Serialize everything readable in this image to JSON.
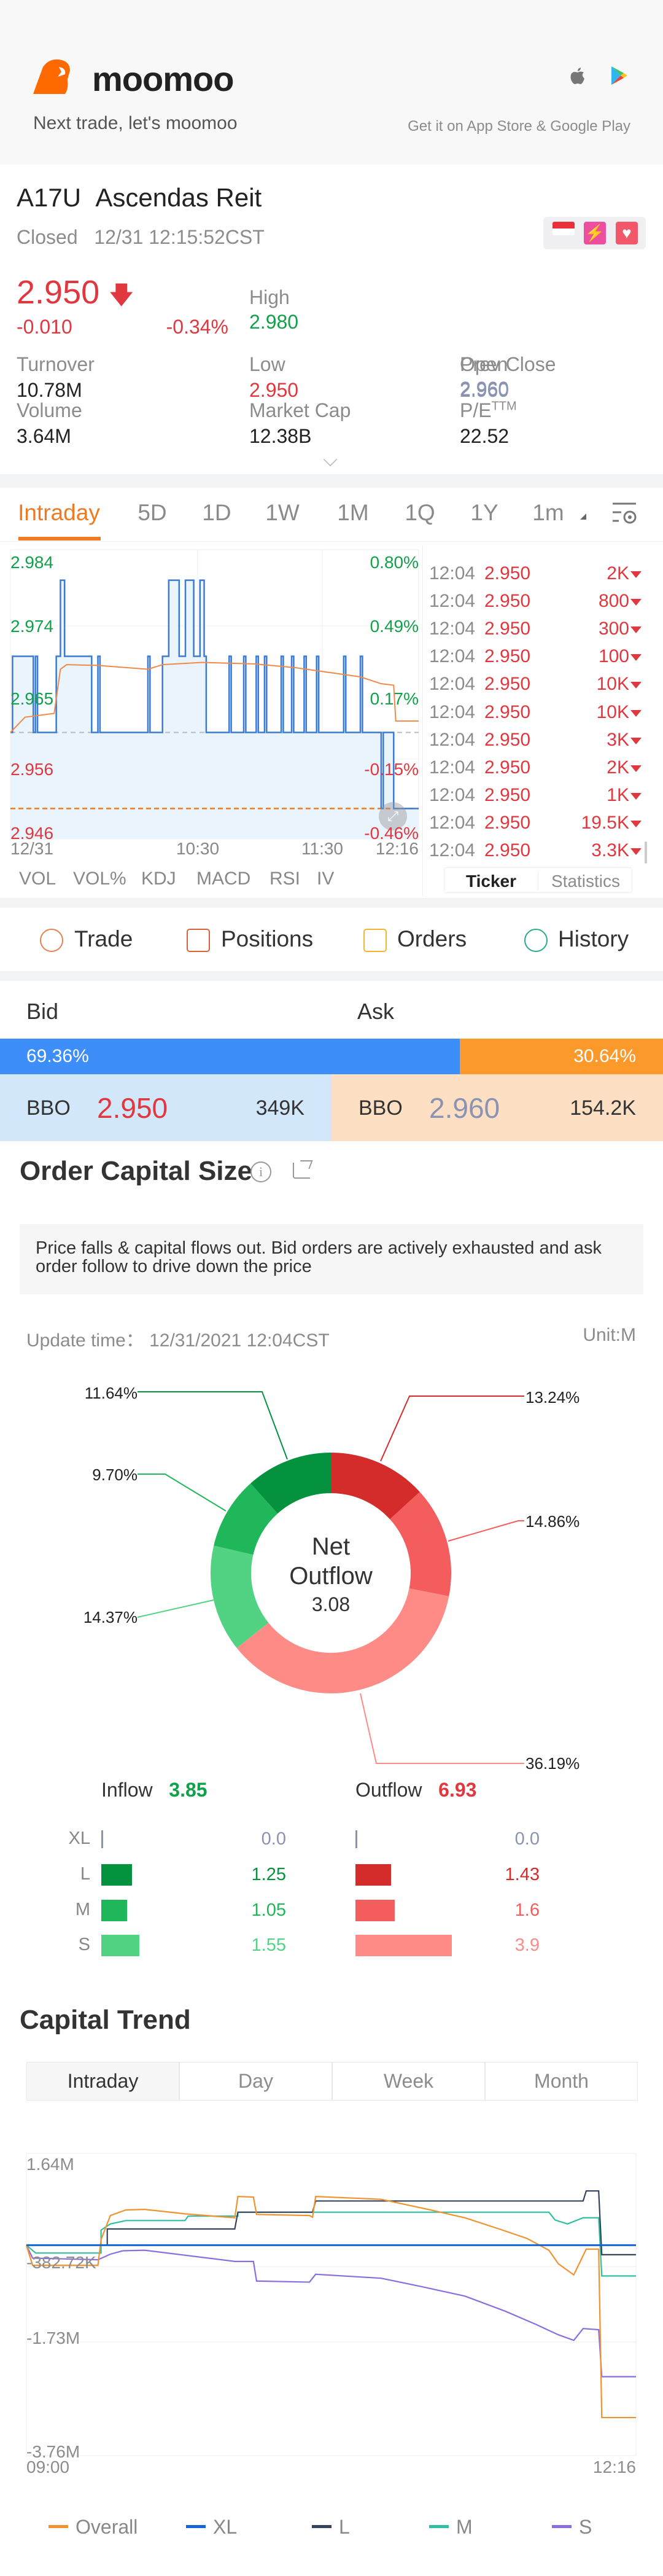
{
  "header": {
    "brand": "moomoo",
    "tagline": "Next trade, let's moomoo",
    "store_text": "Get it on App Store & Google Play",
    "icons": [
      "moomoo-bull-logo",
      "apple-icon",
      "google-play-icon"
    ]
  },
  "quote": {
    "symbol": "A17U",
    "name": "Ascendas Reit",
    "status": "Closed",
    "time": "12/31 12:15:52CST",
    "price": "2.950",
    "change": "-0.010",
    "change_pct": "-0.34%",
    "direction": "down",
    "stats": [
      {
        "label": "High",
        "value": "2.980",
        "color": "green"
      },
      {
        "label": "Open",
        "value": "2.960",
        "color": "gblue"
      },
      {
        "label": "Turnover",
        "value": "10.78M",
        "color": "dark"
      },
      {
        "label": "Low",
        "value": "2.950",
        "color": "red"
      },
      {
        "label": "Prev Close",
        "value": "2.960",
        "color": "gblue"
      },
      {
        "label": "Volume",
        "value": "3.64M",
        "color": "dark"
      },
      {
        "label": "Market Cap",
        "value": "12.38B",
        "color": "dark"
      },
      {
        "label": "P/E",
        "label_sup": "TTM",
        "value": "22.52",
        "color": "dark"
      }
    ],
    "badges": [
      "singapore-flag-icon",
      "lightning-level1-icon",
      "heart-watchlist-icon"
    ]
  },
  "chart_tabs": {
    "items": [
      "Intraday",
      "5D",
      "1D",
      "1W",
      "1M",
      "1Q",
      "1Y",
      "1m"
    ],
    "active": "Intraday"
  },
  "indicators": [
    "VOL",
    "VOL%",
    "KDJ",
    "MACD",
    "RSI",
    "IV"
  ],
  "ticker_tabs": {
    "items": [
      "Ticker",
      "Statistics"
    ],
    "active": "Ticker"
  },
  "ticker": [
    {
      "time": "12:04",
      "price": "2.950",
      "vol": "2K"
    },
    {
      "time": "12:04",
      "price": "2.950",
      "vol": "800"
    },
    {
      "time": "12:04",
      "price": "2.950",
      "vol": "300"
    },
    {
      "time": "12:04",
      "price": "2.950",
      "vol": "100"
    },
    {
      "time": "12:04",
      "price": "2.950",
      "vol": "10K"
    },
    {
      "time": "12:04",
      "price": "2.950",
      "vol": "10K"
    },
    {
      "time": "12:04",
      "price": "2.950",
      "vol": "3K"
    },
    {
      "time": "12:04",
      "price": "2.950",
      "vol": "2K"
    },
    {
      "time": "12:04",
      "price": "2.950",
      "vol": "1K"
    },
    {
      "time": "12:04",
      "price": "2.950",
      "vol": "19.5K"
    },
    {
      "time": "12:04",
      "price": "2.950",
      "vol": "3.3K"
    }
  ],
  "actions": [
    {
      "label": "Trade",
      "icon": "trade-icon"
    },
    {
      "label": "Positions",
      "icon": "positions-icon"
    },
    {
      "label": "Orders",
      "icon": "orders-icon"
    },
    {
      "label": "History",
      "icon": "history-icon"
    }
  ],
  "bidask": {
    "bid_label": "Bid",
    "ask_label": "Ask",
    "bid_pct": 69.36,
    "bid_pct_text": "69.36%",
    "ask_pct_text": "30.64%",
    "bbo_label": "BBO",
    "bid_price": "2.950",
    "bid_size": "349K",
    "ask_price": "2.960",
    "ask_size": "154.2K"
  },
  "order_capital": {
    "title": "Order Capital Size",
    "note": "Price falls & capital flows out. Bid orders are actively exhausted and ask order follow to drive down the price",
    "update_label": "Update time：",
    "update_time": "12/31/2021 12:04CST",
    "unit": "Unit:M",
    "center_line1": "Net",
    "center_line2": "Outflow",
    "center_value": "3.08",
    "inflow_label": "Inflow",
    "inflow_total": "3.85",
    "outflow_label": "Outflow",
    "outflow_total": "6.93",
    "rows": [
      {
        "size": "XL",
        "in": "0.0",
        "out": "0.0"
      },
      {
        "size": "L",
        "in": "1.25",
        "out": "1.43"
      },
      {
        "size": "M",
        "in": "1.05",
        "out": "1.6"
      },
      {
        "size": "S",
        "in": "1.55",
        "out": "3.9"
      }
    ]
  },
  "chart_data": [
    {
      "type": "line",
      "x_range": [
        "09:00",
        "12:16"
      ],
      "ylim": [
        2.946,
        2.984
      ],
      "prev_close": 2.96,
      "current": 2.95,
      "y_ticks": [
        "2.984",
        "2.974",
        "2.965",
        "2.956",
        "2.946"
      ],
      "y_ticks_right": [
        "0.80%",
        "0.49%",
        "0.17%",
        "-0.15%",
        "-0.46%"
      ],
      "x_ticks": [
        "12/31",
        "10:30",
        "11:30",
        "12:16"
      ],
      "colors": {
        "price": "#3a7bd5",
        "avg": "#f08a4b",
        "fill": "#eaf4fd"
      },
      "price": [
        [
          "09:00",
          2.96
        ],
        [
          "09:01",
          2.97
        ],
        [
          "09:11",
          2.96
        ],
        [
          "09:12",
          2.97
        ],
        [
          "09:13",
          2.96
        ],
        [
          "09:22",
          2.97
        ],
        [
          "09:24",
          2.98
        ],
        [
          "09:26",
          2.97
        ],
        [
          "09:39",
          2.96
        ],
        [
          "09:42",
          2.97
        ],
        [
          "09:43",
          2.96
        ],
        [
          "10:06",
          2.97
        ],
        [
          "10:07",
          2.96
        ],
        [
          "10:13",
          2.97
        ],
        [
          "10:16",
          2.98
        ],
        [
          "10:21",
          2.97
        ],
        [
          "10:24",
          2.98
        ],
        [
          "10:28",
          2.97
        ],
        [
          "10:31",
          2.98
        ],
        [
          "10:33",
          2.97
        ],
        [
          "10:34",
          2.96
        ],
        [
          "10:45",
          2.97
        ],
        [
          "10:46",
          2.96
        ],
        [
          "10:52",
          2.97
        ],
        [
          "10:53",
          2.96
        ],
        [
          "10:58",
          2.97
        ],
        [
          "10:59",
          2.96
        ],
        [
          "11:02",
          2.97
        ],
        [
          "11:03",
          2.96
        ],
        [
          "11:10",
          2.97
        ],
        [
          "11:11",
          2.96
        ],
        [
          "11:15",
          2.97
        ],
        [
          "11:16",
          2.96
        ],
        [
          "11:21",
          2.97
        ],
        [
          "11:22",
          2.96
        ],
        [
          "11:27",
          2.97
        ],
        [
          "11:28",
          2.96
        ],
        [
          "11:40",
          2.97
        ],
        [
          "11:41",
          2.96
        ],
        [
          "11:48",
          2.97
        ],
        [
          "11:49",
          2.96
        ],
        [
          "11:58",
          2.95
        ],
        [
          "11:59",
          2.96
        ],
        [
          "12:04",
          2.95
        ],
        [
          "12:16",
          2.95
        ]
      ],
      "avg": [
        [
          "09:00",
          2.96
        ],
        [
          "09:07",
          2.962
        ],
        [
          "09:21",
          2.9625
        ],
        [
          "09:24",
          2.9683
        ],
        [
          "09:27",
          2.9689
        ],
        [
          "09:42",
          2.9688
        ],
        [
          "10:06",
          2.9683
        ],
        [
          "10:13",
          2.9689
        ],
        [
          "10:32",
          2.9692
        ],
        [
          "10:57",
          2.969
        ],
        [
          "11:17",
          2.9685
        ],
        [
          "11:48",
          2.9673
        ],
        [
          "11:58",
          2.9664
        ],
        [
          "12:04",
          2.9662
        ],
        [
          "12:05",
          2.9615
        ],
        [
          "12:16",
          2.9615
        ]
      ]
    },
    {
      "type": "line",
      "title": "Capital Trend",
      "tabs": [
        "Intraday",
        "Day",
        "Week",
        "Month"
      ],
      "active_tab": "Intraday",
      "x_range": [
        "09:00",
        "12:16"
      ],
      "ylim": [
        -3.76,
        1.64
      ],
      "y_ticks": [
        "1.64M",
        "-382.72K",
        "-1.73M",
        "-3.76M"
      ],
      "y_tick_values": [
        1.64,
        -0.38272,
        -1.73,
        -3.76
      ],
      "x_ticks": [
        "09:00",
        "12:16"
      ],
      "unit": "M",
      "series": [
        {
          "name": "Overall",
          "color": "#f0922e",
          "points": [
            [
              "09:00",
              0
            ],
            [
              "09:02",
              -0.36
            ],
            [
              "09:23",
              -0.36
            ],
            [
              "09:24",
              0.1
            ],
            [
              "09:27",
              0.53
            ],
            [
              "09:32",
              0.63
            ],
            [
              "09:38",
              0.64
            ],
            [
              "09:51",
              0.56
            ],
            [
              "10:07",
              0.49
            ],
            [
              "10:08",
              0.87
            ],
            [
              "10:13",
              0.86
            ],
            [
              "10:14",
              0.55
            ],
            [
              "10:31",
              0.53
            ],
            [
              "10:32",
              0.5
            ],
            [
              "10:33",
              0.87
            ],
            [
              "10:54",
              0.82
            ],
            [
              "11:10",
              0.63
            ],
            [
              "11:21",
              0.49
            ],
            [
              "11:32",
              0.29
            ],
            [
              "11:41",
              0.12
            ],
            [
              "11:48",
              -0.09
            ],
            [
              "11:51",
              -0.33
            ],
            [
              "11:56",
              -0.53
            ],
            [
              "12:00",
              -0.07
            ],
            [
              "12:04",
              -0.07
            ],
            [
              "12:05",
              -3.08
            ],
            [
              "12:16",
              -3.08
            ]
          ]
        },
        {
          "name": "XL",
          "color": "#1565d8",
          "points": [
            [
              "09:00",
              0
            ],
            [
              "12:16",
              0
            ]
          ]
        },
        {
          "name": "L",
          "color": "#34445c",
          "points": [
            [
              "09:00",
              0
            ],
            [
              "09:26",
              0
            ],
            [
              "09:26",
              0.29
            ],
            [
              "10:07",
              0.29
            ],
            [
              "10:08",
              0.59
            ],
            [
              "10:32",
              0.59
            ],
            [
              "10:33",
              0.79
            ],
            [
              "11:59",
              0.79
            ],
            [
              "12:00",
              0.97
            ],
            [
              "12:04",
              0.97
            ],
            [
              "12:05",
              -0.17
            ],
            [
              "12:16",
              -0.17
            ]
          ]
        },
        {
          "name": "M",
          "color": "#2ebfa5",
          "points": [
            [
              "09:00",
              0
            ],
            [
              "09:03",
              -0.14
            ],
            [
              "09:24",
              -0.14
            ],
            [
              "09:24",
              0.27
            ],
            [
              "09:27",
              0.38
            ],
            [
              "09:32",
              0.44
            ],
            [
              "09:51",
              0.44
            ],
            [
              "09:52",
              0.52
            ],
            [
              "10:08",
              0.52
            ],
            [
              "10:08",
              0.59
            ],
            [
              "11:48",
              0.59
            ],
            [
              "11:50",
              0.45
            ],
            [
              "11:54",
              0.38
            ],
            [
              "11:59",
              0.49
            ],
            [
              "12:04",
              0.49
            ],
            [
              "12:05",
              -0.55
            ],
            [
              "12:16",
              -0.55
            ]
          ]
        },
        {
          "name": "S",
          "color": "#8a6ee0",
          "points": [
            [
              "09:00",
              0
            ],
            [
              "09:02",
              -0.23
            ],
            [
              "09:23",
              -0.26
            ],
            [
              "09:27",
              -0.16
            ],
            [
              "09:31",
              -0.1
            ],
            [
              "09:38",
              -0.09
            ],
            [
              "10:07",
              -0.29
            ],
            [
              "10:13",
              -0.29
            ],
            [
              "10:14",
              -0.64
            ],
            [
              "10:31",
              -0.66
            ],
            [
              "10:33",
              -0.52
            ],
            [
              "10:54",
              -0.59
            ],
            [
              "11:07",
              -0.74
            ],
            [
              "11:21",
              -0.91
            ],
            [
              "11:34",
              -1.18
            ],
            [
              "11:44",
              -1.42
            ],
            [
              "11:51",
              -1.6
            ],
            [
              "11:56",
              -1.7
            ],
            [
              "11:59",
              -1.49
            ],
            [
              "12:04",
              -1.51
            ],
            [
              "12:05",
              -2.35
            ],
            [
              "12:16",
              -2.35
            ]
          ]
        }
      ]
    },
    {
      "type": "pie",
      "style": "donut",
      "slices": [
        {
          "label": "13.24%",
          "value": 13.24,
          "flow": "outflow",
          "size": "L",
          "color": "#d42b2b"
        },
        {
          "label": "14.86%",
          "value": 14.86,
          "flow": "outflow",
          "size": "M",
          "color": "#f45d5d"
        },
        {
          "label": "36.19%",
          "value": 36.19,
          "flow": "outflow",
          "size": "S",
          "color": "#ff8b86"
        },
        {
          "label": "14.37%",
          "value": 14.37,
          "flow": "inflow",
          "size": "S",
          "color": "#52d384"
        },
        {
          "label": "9.70%",
          "value": 9.7,
          "flow": "inflow",
          "size": "M",
          "color": "#20b75a"
        },
        {
          "label": "11.64%",
          "value": 11.64,
          "flow": "inflow",
          "size": "L",
          "color": "#05923f"
        }
      ]
    },
    {
      "type": "bar",
      "orientation": "horizontal",
      "categories": [
        "XL",
        "L",
        "M",
        "S"
      ],
      "series": [
        {
          "name": "Inflow",
          "values": [
            0,
            1.25,
            1.05,
            1.55
          ],
          "colors": [
            "#8a93b2",
            "#05923f",
            "#20b75a",
            "#52d384"
          ]
        },
        {
          "name": "Outflow",
          "values": [
            0,
            1.43,
            1.6,
            3.9
          ],
          "colors": [
            "#8a93b2",
            "#d42b2b",
            "#f45d5d",
            "#ff8b86"
          ]
        }
      ]
    }
  ],
  "colors": {
    "brand": "#ff6a00",
    "accent": "#f07a22",
    "up": "#11a14a",
    "down": "#e0383e",
    "bid": "#3d8ef8",
    "ask": "#fb9a2a",
    "bid_bg": "#d3e7fb",
    "ask_bg": "#fde0c4"
  }
}
